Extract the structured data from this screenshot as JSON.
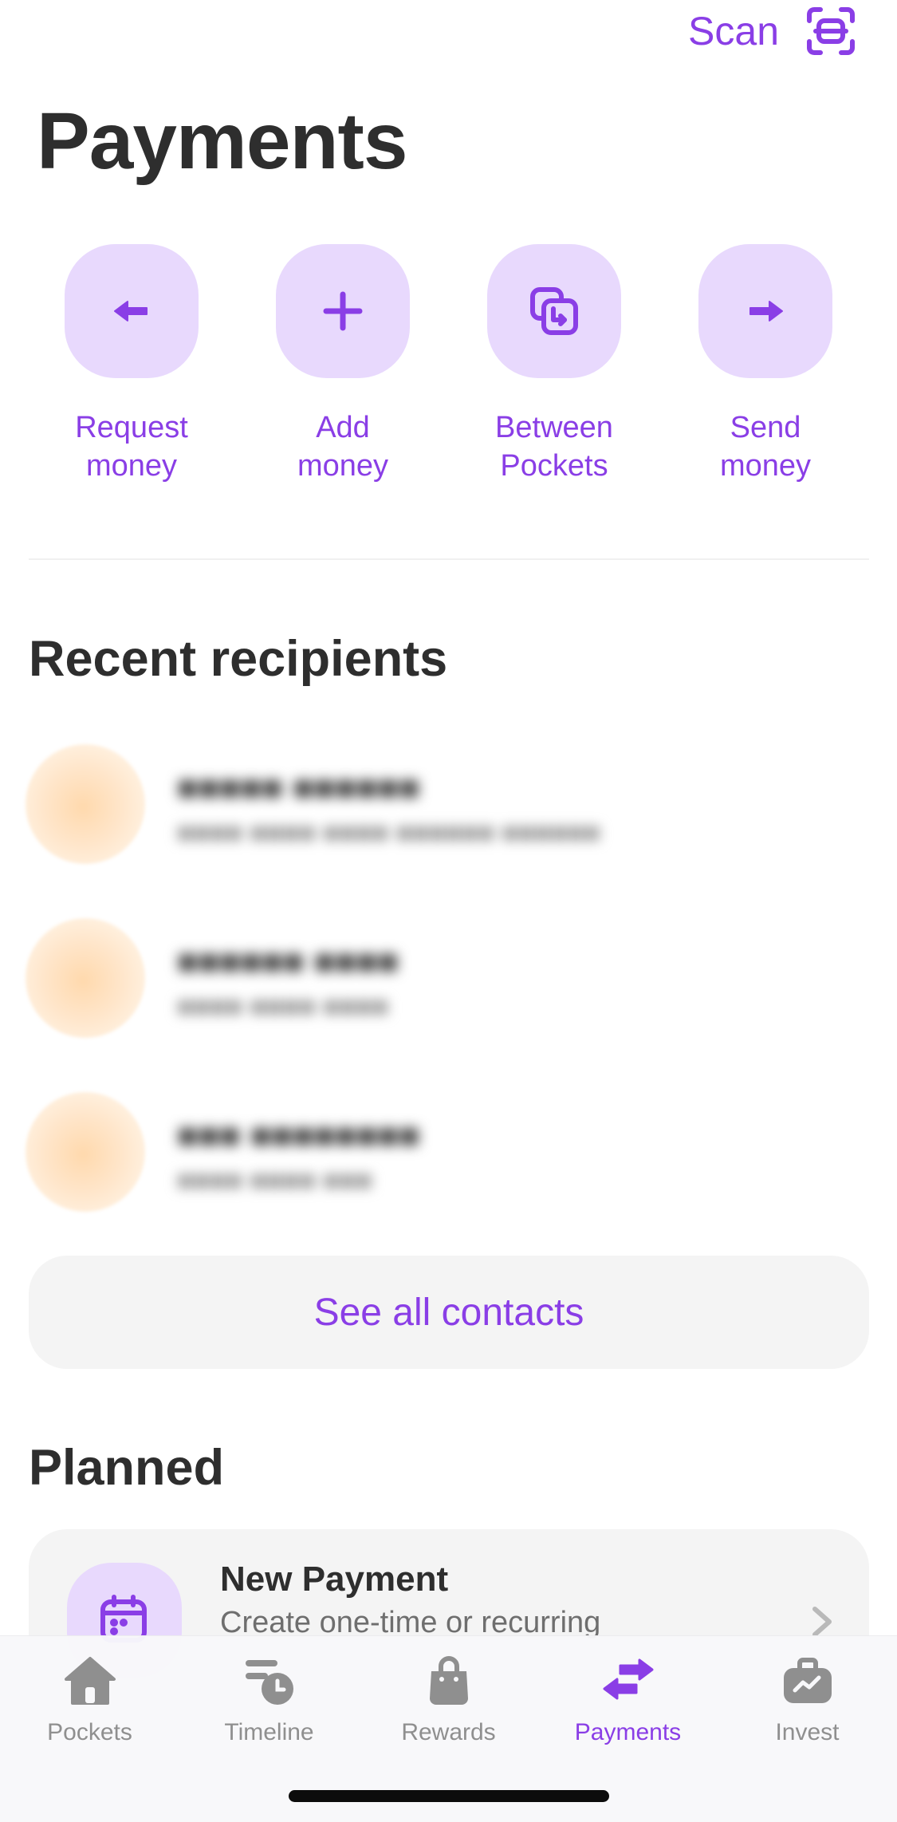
{
  "header": {
    "scan_label": "Scan",
    "scan_icon": "scan-icon",
    "title": "Payments"
  },
  "actions": [
    {
      "label_line1": "Request",
      "label_line2": "money",
      "icon": "arrow-left-icon"
    },
    {
      "label_line1": "Add",
      "label_line2": "money",
      "icon": "plus-icon"
    },
    {
      "label_line1": "Between",
      "label_line2": "Pockets",
      "icon": "pockets-transfer-icon"
    },
    {
      "label_line1": "Send",
      "label_line2": "money",
      "icon": "arrow-right-icon"
    }
  ],
  "recent": {
    "title": "Recent recipients",
    "see_all_label": "See all contacts"
  },
  "planned": {
    "title": "Planned",
    "card_title": "New Payment",
    "card_subtitle": "Create one-time or recurring",
    "icon": "calendar-icon"
  },
  "tabs": [
    {
      "label": "Pockets",
      "icon": "home-icon",
      "active": false
    },
    {
      "label": "Timeline",
      "icon": "timeline-icon",
      "active": false
    },
    {
      "label": "Rewards",
      "icon": "shopping-bag-icon",
      "active": false
    },
    {
      "label": "Payments",
      "icon": "transfer-arrows-icon",
      "active": true
    },
    {
      "label": "Invest",
      "icon": "briefcase-icon",
      "active": false
    }
  ],
  "colors": {
    "accent": "#8a3ee6",
    "accent_soft": "#e8d9fd",
    "text": "#2e2e2e",
    "muted": "#8f8f8f",
    "card": "#f4f4f4"
  }
}
